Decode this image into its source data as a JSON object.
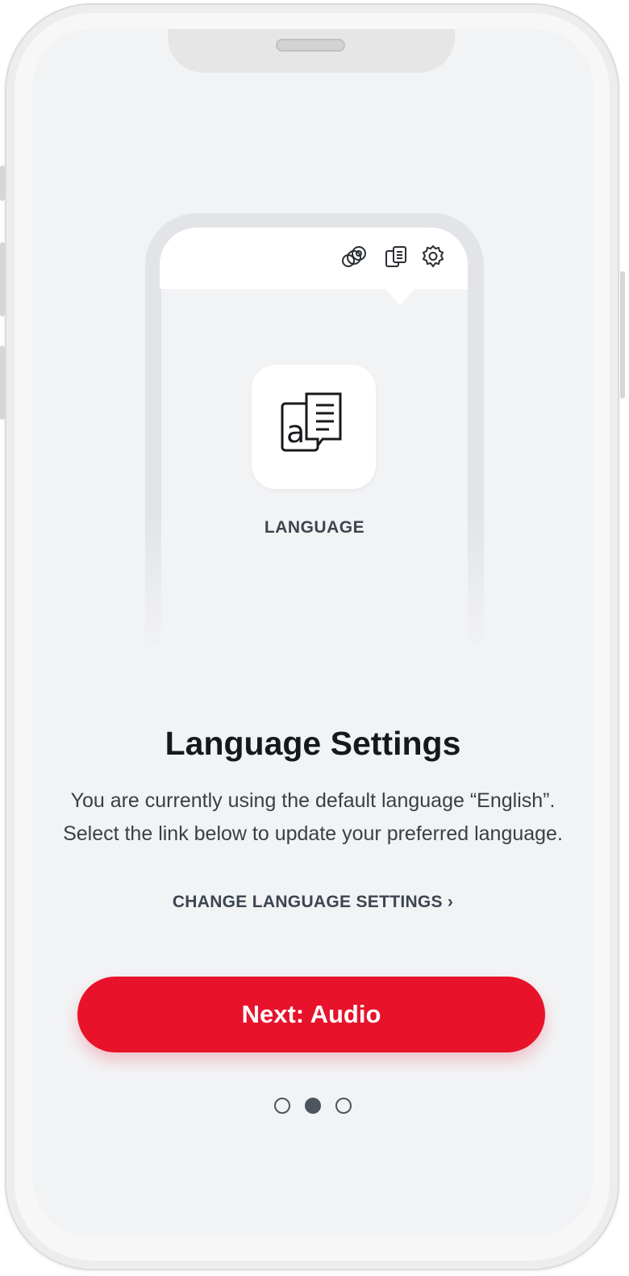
{
  "illustration": {
    "header_icons": [
      "language-circles-icon",
      "translate-icon",
      "gear-icon"
    ],
    "tile_icon": "translate-icon",
    "tile_label": "LANGUAGE"
  },
  "content": {
    "title": "Language Settings",
    "description_line1": "You are currently using the default language “English”.",
    "description_line2": "Select the link below to update your preferred language.",
    "link_label": "CHANGE LANGUAGE SETTINGS",
    "link_chevron": "›"
  },
  "cta": {
    "label": "Next: Audio"
  },
  "pagination": {
    "total": 3,
    "current": 2
  },
  "colors": {
    "accent": "#e8122b",
    "background": "#f2f3f5",
    "text_dark": "#15191e",
    "text_muted": "#3d4550"
  }
}
